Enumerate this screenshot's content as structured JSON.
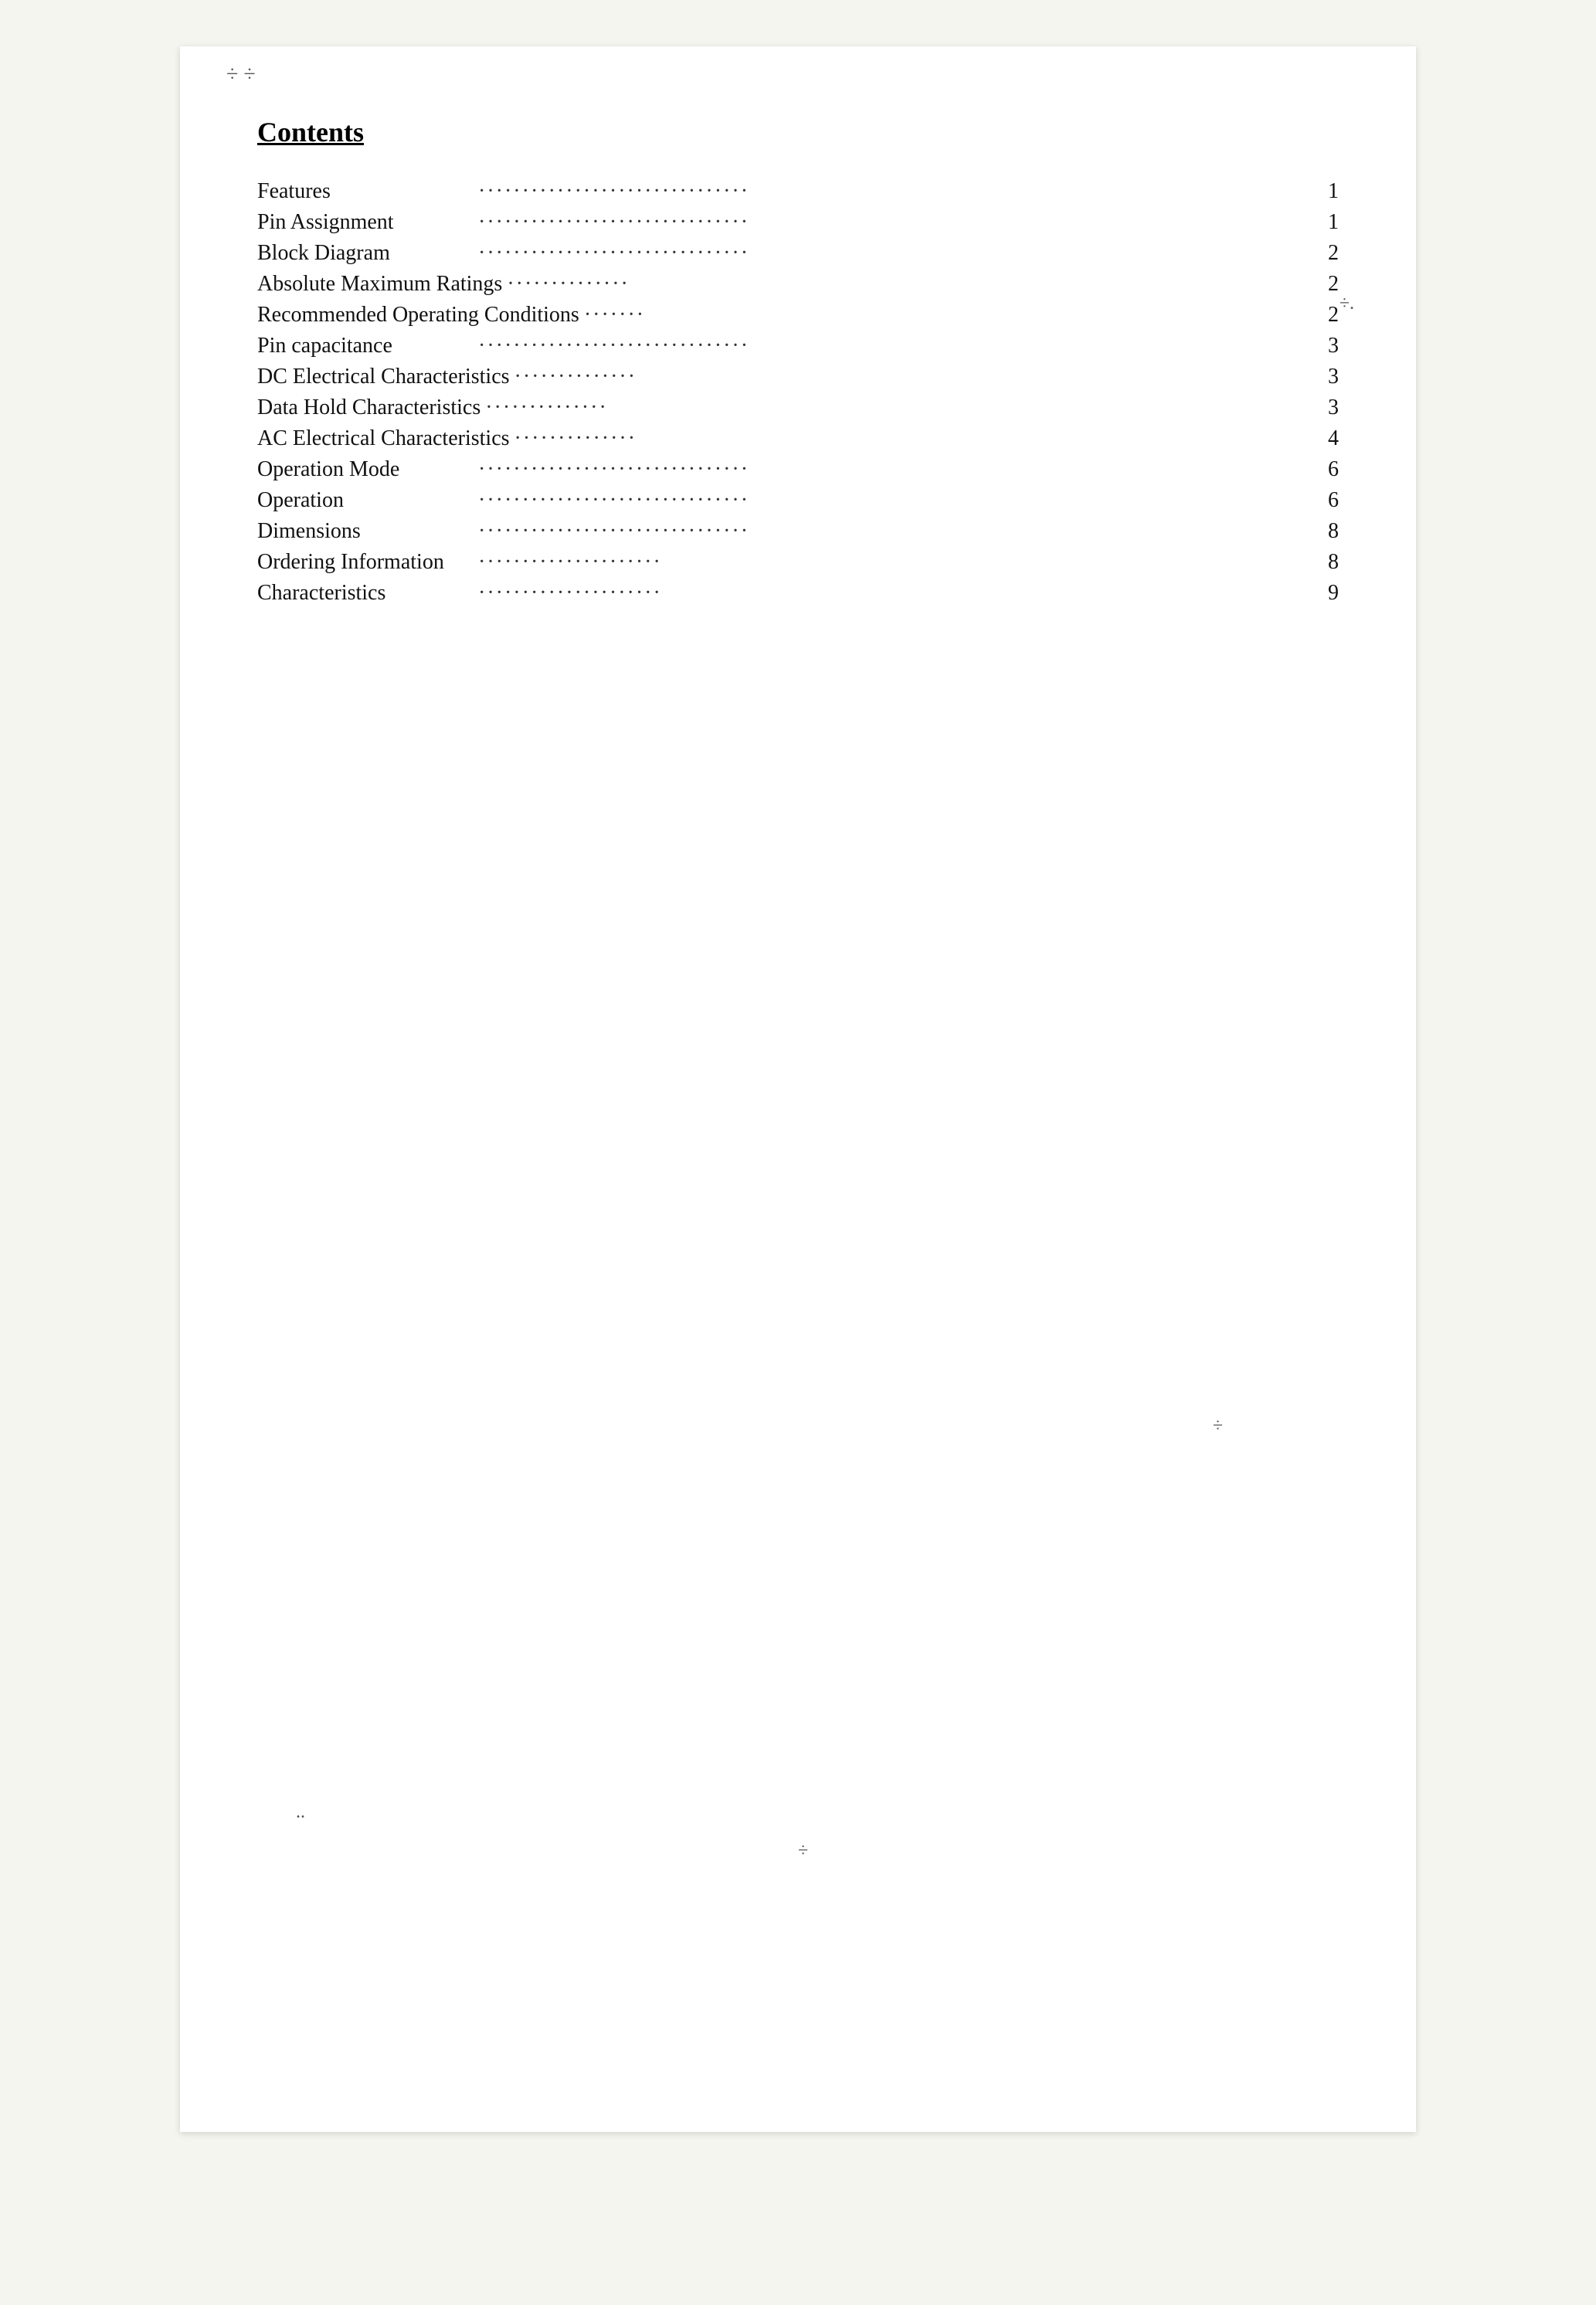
{
  "page": {
    "corner_marks": "÷  ÷",
    "title": "Contents",
    "toc": [
      {
        "label": "Features",
        "dots": "·······························",
        "page": "1"
      },
      {
        "label": "Pin Assignment",
        "dots": "·······························",
        "page": "1"
      },
      {
        "label": "Block Diagram",
        "dots": "·······························",
        "page": "2"
      },
      {
        "label": "Absolute Maximum Ratings",
        "dots": "··············",
        "page": "2"
      },
      {
        "label": "Recommended Operating Conditions",
        "dots": "·······",
        "page": "2"
      },
      {
        "label": "Pin capacitance",
        "dots": "·······························",
        "page": "3"
      },
      {
        "label": "DC Electrical Characteristics",
        "dots": "··············",
        "page": "3"
      },
      {
        "label": "Data Hold Characteristics",
        "dots": "··············",
        "page": "3"
      },
      {
        "label": "AC Electrical Characteristics",
        "dots": "··············",
        "page": "4"
      },
      {
        "label": "Operation Mode",
        "dots": "·······························",
        "page": "6"
      },
      {
        "label": "Operation",
        "dots": "·······························",
        "page": "6"
      },
      {
        "label": "Dimensions",
        "dots": "·······························",
        "page": "8"
      },
      {
        "label": "Ordering Information",
        "dots": "·····················",
        "page": "8"
      },
      {
        "label": "Characteristics",
        "dots": "·····················",
        "page": "9"
      }
    ],
    "side_mark": "÷.",
    "side_mark_bottom": "÷",
    "bottom_mark": "..",
    "bottom_mark_center": "÷"
  }
}
